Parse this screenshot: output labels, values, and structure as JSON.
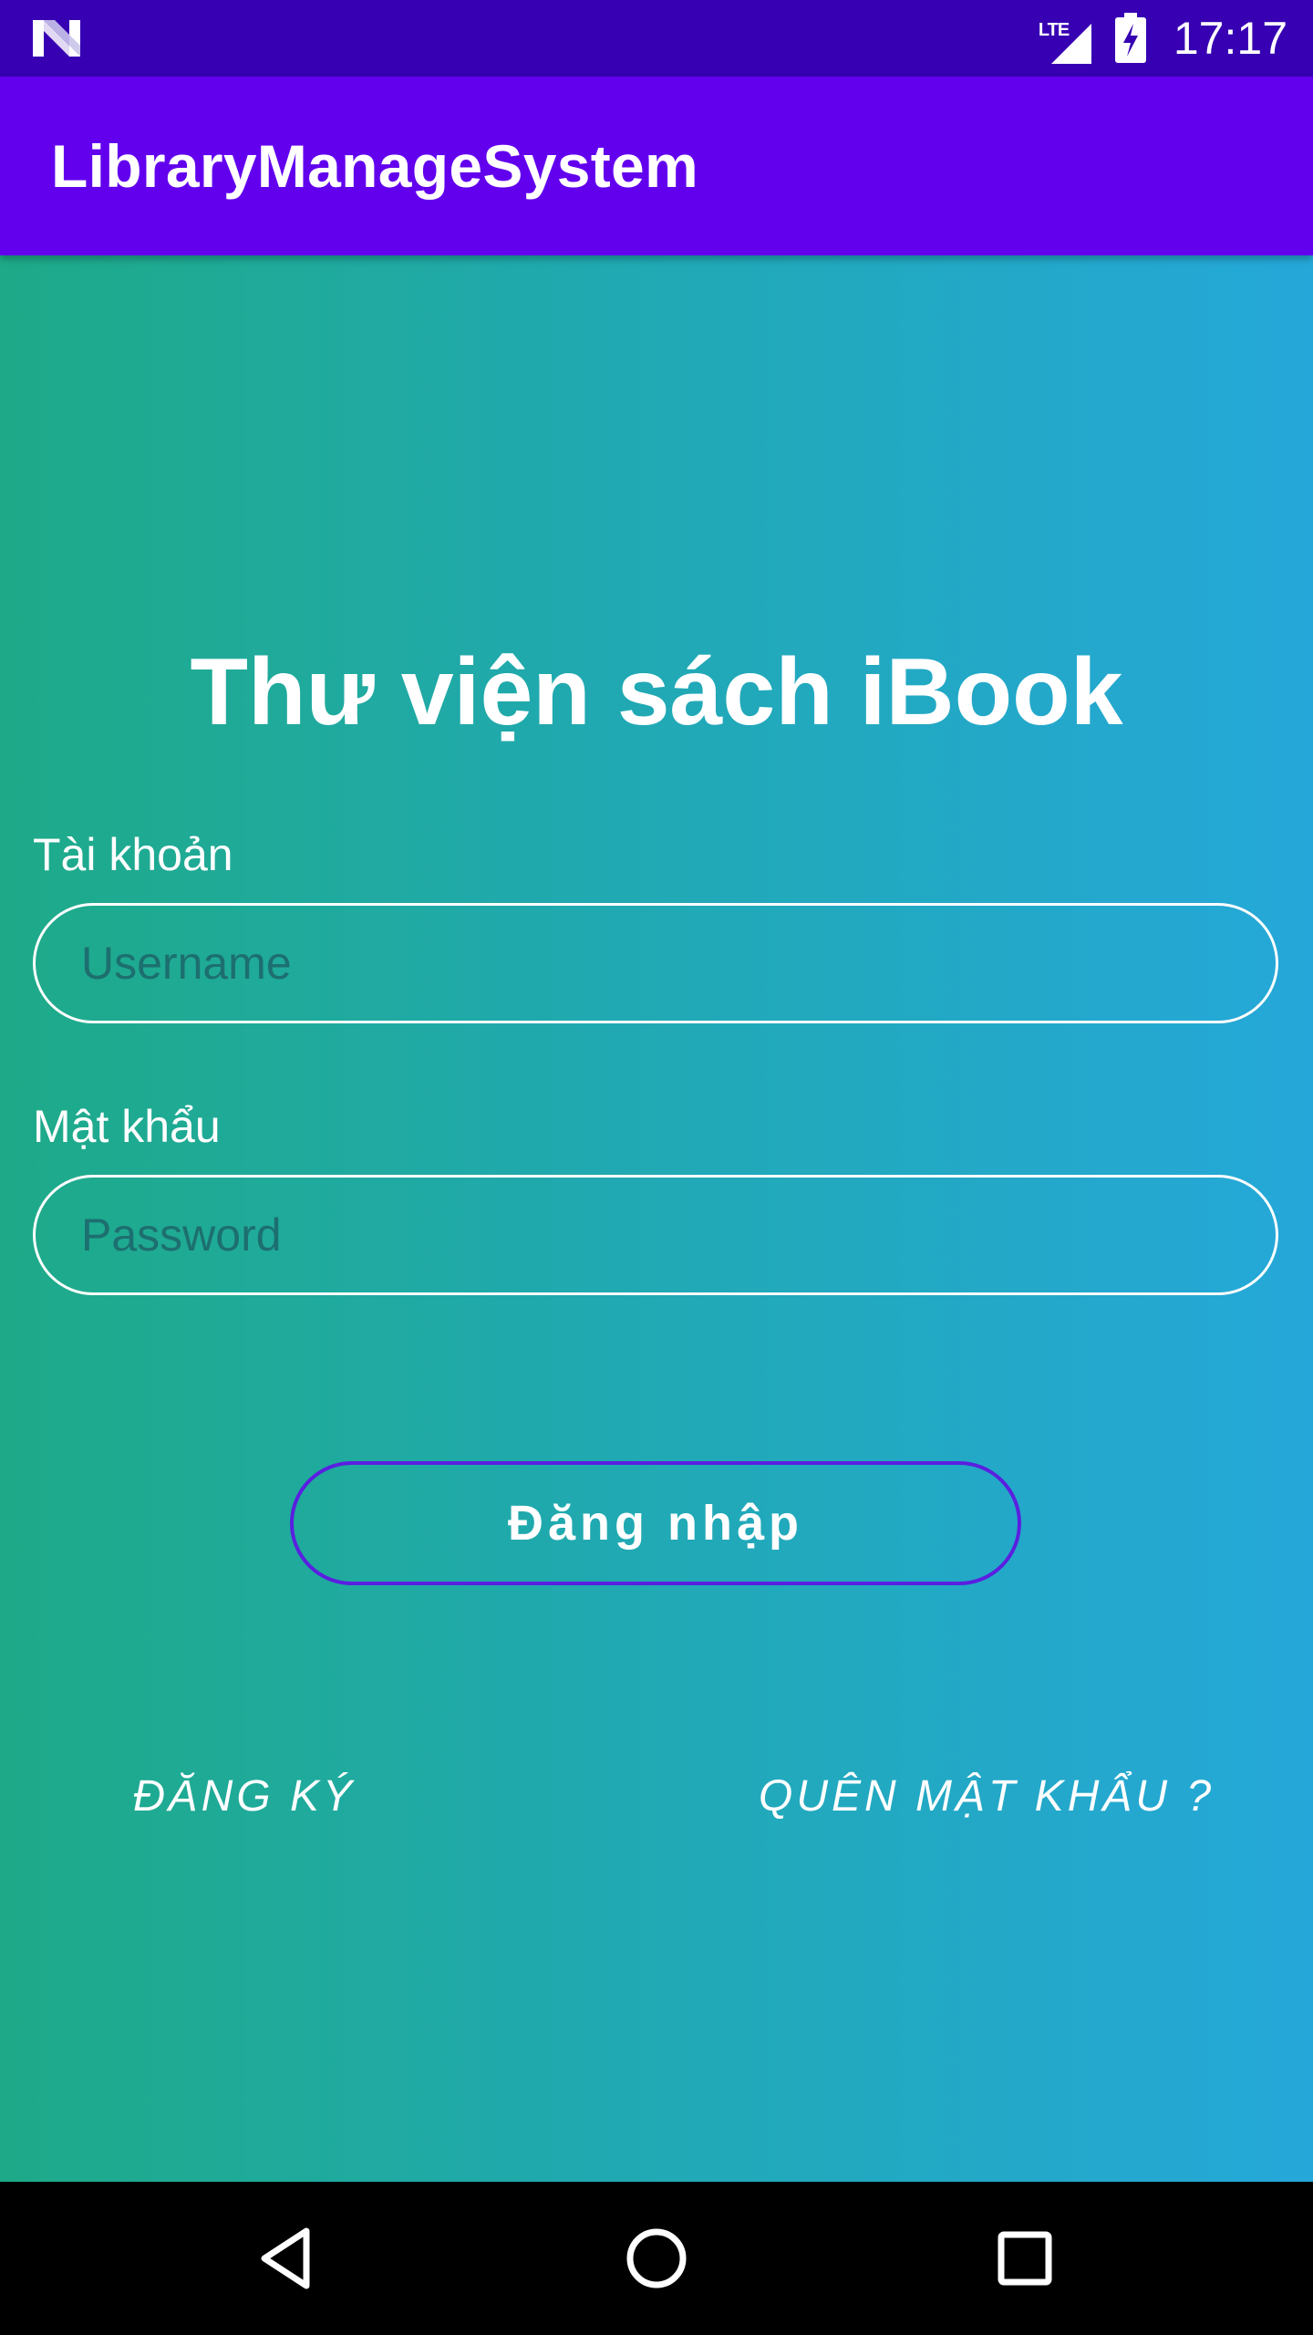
{
  "status_bar": {
    "network_label": "LTE",
    "time": "17:17",
    "icons": [
      "android-n-logo-icon",
      "lte-signal-icon",
      "battery-charging-icon"
    ]
  },
  "app_bar": {
    "title": "LibraryManageSystem",
    "color": "#6200ee"
  },
  "login": {
    "heading": "Thư viện sách iBook",
    "username_label": "Tài khoản",
    "username_placeholder": "Username",
    "username_value": "",
    "password_label": "Mật khẩu",
    "password_placeholder": "Password",
    "password_value": "",
    "login_button": "Đăng nhập",
    "register_link": "ĐĂNG KÝ",
    "forgot_link": "QUÊN MẬT KHẨU ?"
  },
  "nav_bar": {
    "icons": [
      "back-icon",
      "home-icon",
      "recents-icon"
    ]
  },
  "colors": {
    "status_bar": "#3700b3",
    "gradient_start": "#1eaa88",
    "gradient_end": "#25a8d9",
    "login_button_border": "#5a1fe0"
  }
}
